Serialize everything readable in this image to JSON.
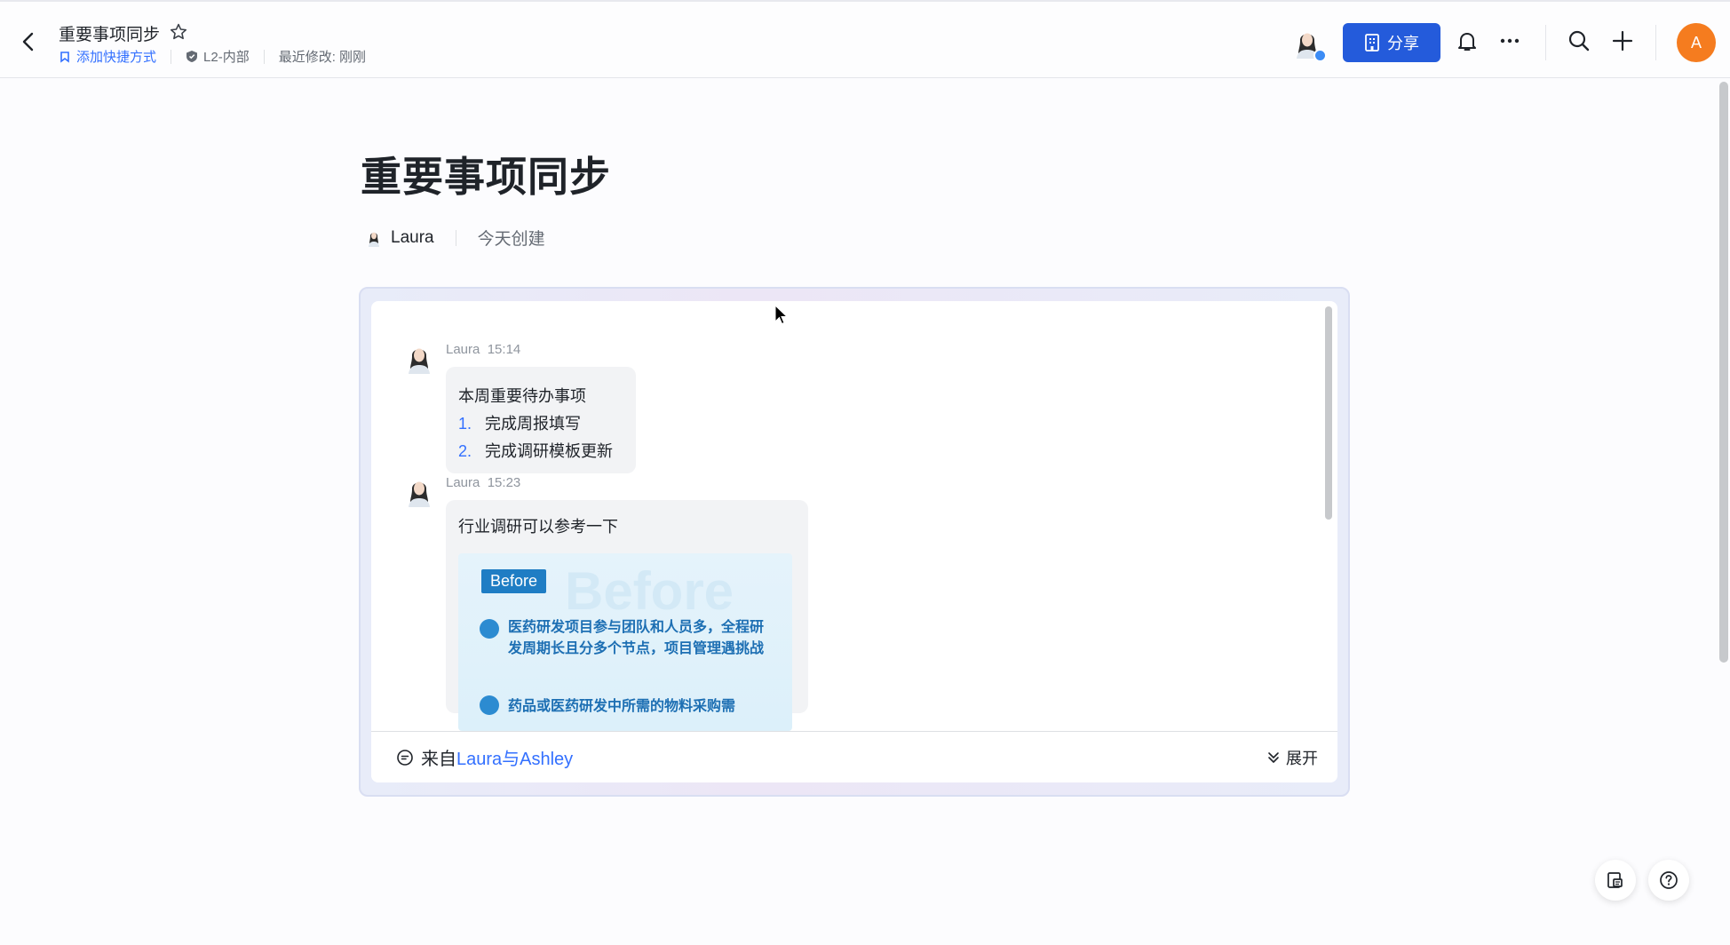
{
  "header": {
    "title": "重要事项同步",
    "add_shortcut": "添加快捷方式",
    "security_level": "L2-内部",
    "last_modified": "最近修改: 刚刚",
    "share_label": "分享",
    "user_initial": "A"
  },
  "doc": {
    "title": "重要事项同步",
    "author": "Laura",
    "created": "今天创建"
  },
  "chat": {
    "messages": [
      {
        "sender": "Laura",
        "time": "15:14",
        "title": "本周重要待办事项",
        "items": [
          {
            "num": "1.",
            "text": "完成周报填写"
          },
          {
            "num": "2.",
            "text": "完成调研模板更新"
          }
        ]
      },
      {
        "sender": "Laura",
        "time": "15:23",
        "text": "行业调研可以参考一下",
        "image": {
          "watermark": "Before",
          "badge": "Before",
          "point1": "医药研发项目参与团队和人员多，全程研发周期长且分多个节点，项目管理遇挑战",
          "point2": "药品或医药研发中所需的物料采购需"
        }
      }
    ],
    "footer_prefix": "来自",
    "footer_source": "Laura与Ashley",
    "expand_label": "展开"
  },
  "colors": {
    "accent": "#3370ff",
    "share_button": "#245bdb",
    "user_avatar": "#f57c1f"
  }
}
